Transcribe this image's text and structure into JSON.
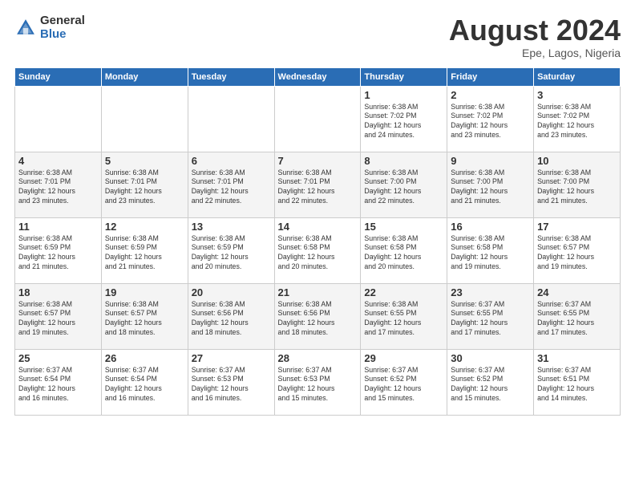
{
  "header": {
    "logo": {
      "line1": "General",
      "line2": "Blue"
    },
    "title": "August 2024",
    "location": "Epe, Lagos, Nigeria"
  },
  "calendar": {
    "weekdays": [
      "Sunday",
      "Monday",
      "Tuesday",
      "Wednesday",
      "Thursday",
      "Friday",
      "Saturday"
    ],
    "weeks": [
      [
        {
          "day": "",
          "info": ""
        },
        {
          "day": "",
          "info": ""
        },
        {
          "day": "",
          "info": ""
        },
        {
          "day": "",
          "info": ""
        },
        {
          "day": "1",
          "info": "Sunrise: 6:38 AM\nSunset: 7:02 PM\nDaylight: 12 hours\nand 24 minutes."
        },
        {
          "day": "2",
          "info": "Sunrise: 6:38 AM\nSunset: 7:02 PM\nDaylight: 12 hours\nand 23 minutes."
        },
        {
          "day": "3",
          "info": "Sunrise: 6:38 AM\nSunset: 7:02 PM\nDaylight: 12 hours\nand 23 minutes."
        }
      ],
      [
        {
          "day": "4",
          "info": "Sunrise: 6:38 AM\nSunset: 7:01 PM\nDaylight: 12 hours\nand 23 minutes."
        },
        {
          "day": "5",
          "info": "Sunrise: 6:38 AM\nSunset: 7:01 PM\nDaylight: 12 hours\nand 23 minutes."
        },
        {
          "day": "6",
          "info": "Sunrise: 6:38 AM\nSunset: 7:01 PM\nDaylight: 12 hours\nand 22 minutes."
        },
        {
          "day": "7",
          "info": "Sunrise: 6:38 AM\nSunset: 7:01 PM\nDaylight: 12 hours\nand 22 minutes."
        },
        {
          "day": "8",
          "info": "Sunrise: 6:38 AM\nSunset: 7:00 PM\nDaylight: 12 hours\nand 22 minutes."
        },
        {
          "day": "9",
          "info": "Sunrise: 6:38 AM\nSunset: 7:00 PM\nDaylight: 12 hours\nand 21 minutes."
        },
        {
          "day": "10",
          "info": "Sunrise: 6:38 AM\nSunset: 7:00 PM\nDaylight: 12 hours\nand 21 minutes."
        }
      ],
      [
        {
          "day": "11",
          "info": "Sunrise: 6:38 AM\nSunset: 6:59 PM\nDaylight: 12 hours\nand 21 minutes."
        },
        {
          "day": "12",
          "info": "Sunrise: 6:38 AM\nSunset: 6:59 PM\nDaylight: 12 hours\nand 21 minutes."
        },
        {
          "day": "13",
          "info": "Sunrise: 6:38 AM\nSunset: 6:59 PM\nDaylight: 12 hours\nand 20 minutes."
        },
        {
          "day": "14",
          "info": "Sunrise: 6:38 AM\nSunset: 6:58 PM\nDaylight: 12 hours\nand 20 minutes."
        },
        {
          "day": "15",
          "info": "Sunrise: 6:38 AM\nSunset: 6:58 PM\nDaylight: 12 hours\nand 20 minutes."
        },
        {
          "day": "16",
          "info": "Sunrise: 6:38 AM\nSunset: 6:58 PM\nDaylight: 12 hours\nand 19 minutes."
        },
        {
          "day": "17",
          "info": "Sunrise: 6:38 AM\nSunset: 6:57 PM\nDaylight: 12 hours\nand 19 minutes."
        }
      ],
      [
        {
          "day": "18",
          "info": "Sunrise: 6:38 AM\nSunset: 6:57 PM\nDaylight: 12 hours\nand 19 minutes."
        },
        {
          "day": "19",
          "info": "Sunrise: 6:38 AM\nSunset: 6:57 PM\nDaylight: 12 hours\nand 18 minutes."
        },
        {
          "day": "20",
          "info": "Sunrise: 6:38 AM\nSunset: 6:56 PM\nDaylight: 12 hours\nand 18 minutes."
        },
        {
          "day": "21",
          "info": "Sunrise: 6:38 AM\nSunset: 6:56 PM\nDaylight: 12 hours\nand 18 minutes."
        },
        {
          "day": "22",
          "info": "Sunrise: 6:38 AM\nSunset: 6:55 PM\nDaylight: 12 hours\nand 17 minutes."
        },
        {
          "day": "23",
          "info": "Sunrise: 6:37 AM\nSunset: 6:55 PM\nDaylight: 12 hours\nand 17 minutes."
        },
        {
          "day": "24",
          "info": "Sunrise: 6:37 AM\nSunset: 6:55 PM\nDaylight: 12 hours\nand 17 minutes."
        }
      ],
      [
        {
          "day": "25",
          "info": "Sunrise: 6:37 AM\nSunset: 6:54 PM\nDaylight: 12 hours\nand 16 minutes."
        },
        {
          "day": "26",
          "info": "Sunrise: 6:37 AM\nSunset: 6:54 PM\nDaylight: 12 hours\nand 16 minutes."
        },
        {
          "day": "27",
          "info": "Sunrise: 6:37 AM\nSunset: 6:53 PM\nDaylight: 12 hours\nand 16 minutes."
        },
        {
          "day": "28",
          "info": "Sunrise: 6:37 AM\nSunset: 6:53 PM\nDaylight: 12 hours\nand 15 minutes."
        },
        {
          "day": "29",
          "info": "Sunrise: 6:37 AM\nSunset: 6:52 PM\nDaylight: 12 hours\nand 15 minutes."
        },
        {
          "day": "30",
          "info": "Sunrise: 6:37 AM\nSunset: 6:52 PM\nDaylight: 12 hours\nand 15 minutes."
        },
        {
          "day": "31",
          "info": "Sunrise: 6:37 AM\nSunset: 6:51 PM\nDaylight: 12 hours\nand 14 minutes."
        }
      ]
    ]
  }
}
